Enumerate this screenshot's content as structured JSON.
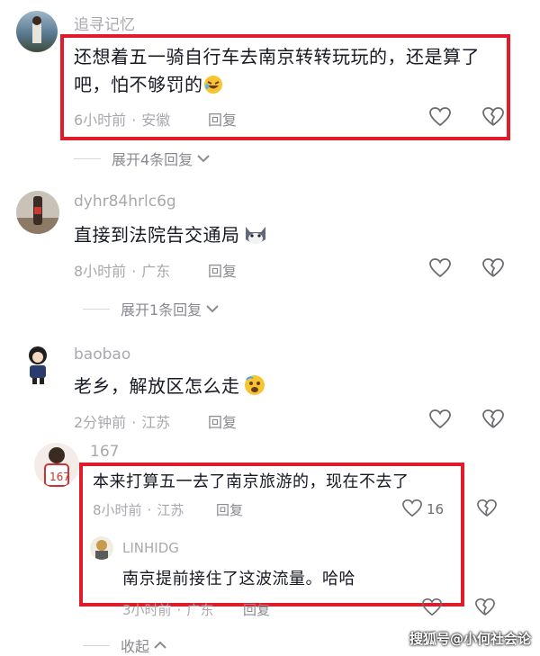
{
  "comments": [
    {
      "username": "追寻记忆",
      "text": "还想着五一骑自行车去南京转转玩玩的，还是算了吧，怕不够罚的",
      "time": "6小时前",
      "location": "安徽",
      "reply_label": "回复",
      "expand_label": "展开4条回复"
    },
    {
      "username": "dyhr84hrlc6g",
      "text": "直接到法院告交通局",
      "time": "8小时前",
      "location": "广东",
      "reply_label": "回复",
      "expand_label": "展开1条回复"
    },
    {
      "username": "baobao",
      "text": "老乡，解放区怎么走",
      "time": "2分钟前",
      "location": "江苏",
      "reply_label": "回复"
    },
    {
      "username": "167",
      "text": "本来打算五一去了南京旅游的，现在不去了",
      "time": "8小时前",
      "location": "江苏",
      "reply_label": "回复",
      "like_count": "16",
      "sub_reply": {
        "username": "LINHIDG",
        "text": "南京提前接住了这波流量。哈哈",
        "time": "3小时前",
        "location": "广东",
        "reply_label": "回复"
      }
    }
  ],
  "collapse_label": "收起",
  "watermark": "搜狐号@小何社会论",
  "colors": {
    "highlight_border": "#e01c2a",
    "meta_text": "#a8a8ad",
    "body_text": "#161823"
  },
  "icons": [
    "heart-outline-icon",
    "broken-heart-icon",
    "chevron-down-icon",
    "chevron-up-icon",
    "laughing-emoji",
    "cat-emoji",
    "scared-emoji"
  ]
}
